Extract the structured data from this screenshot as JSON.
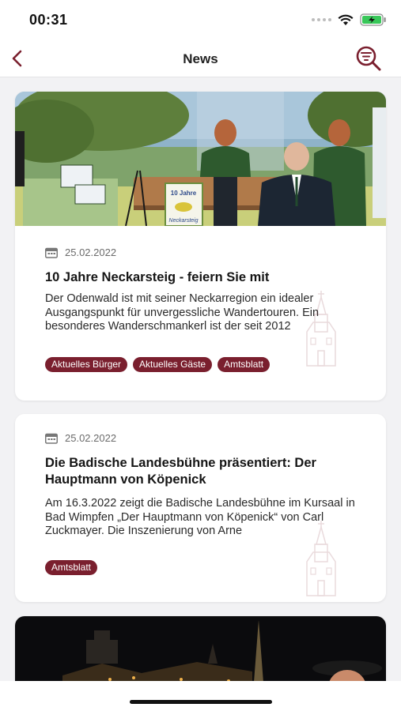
{
  "status_bar": {
    "time": "00:31",
    "icons": [
      "signal-dots-icon",
      "wifi-icon",
      "battery-charging-icon"
    ]
  },
  "header": {
    "title": "News",
    "back_icon": "chevron-left-icon",
    "search_icon": "search-filter-icon"
  },
  "colors": {
    "accent": "#7a1f2e",
    "background": "#f2f2f4",
    "card": "#ffffff"
  },
  "articles": [
    {
      "date": "25.02.2022",
      "title": "10 Jahre Neckarsteig - feiern Sie mit",
      "excerpt": "Der Odenwald ist mit seiner Neckarregion ein idealer Ausgangspunkt für unvergessliche Wandertouren. Ein besonderes Wanderschmankerl ist der seit 2012",
      "tags": [
        "Aktuelles Bürger",
        "Aktuelles Gäste",
        "Amtsblatt"
      ],
      "image_sign": {
        "line1": "10 Jahre",
        "line2": "Neckarsteig"
      }
    },
    {
      "date": "25.02.2022",
      "title": "Die Badische Landesbühne präsentiert: Der Hauptmann von Köpenick",
      "excerpt": "Am 16.3.2022 zeigt die Badische Landesbühne im Kursaal in Bad Wimpfen „Der Hauptmann von Köpenick“ von Carl Zuckmayer. Die Inszenierung von Arne",
      "tags": [
        "Amtsblatt"
      ]
    }
  ]
}
